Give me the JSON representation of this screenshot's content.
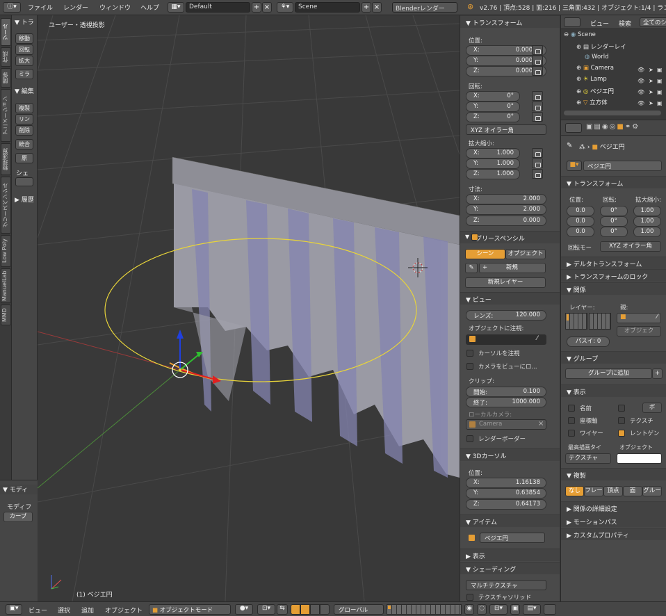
{
  "menu": {
    "items": [
      "ファイル",
      "レンダー",
      "ウィンドウ",
      "ヘルプ"
    ]
  },
  "topbar": {
    "layout": "Default",
    "scene": "Scene",
    "engine": "Blenderレンダー",
    "stats": "v2.76 | 頂点:528 | 面:216 | 三角面:432 | オブジェクト:1/4 | ランプ"
  },
  "shelf": {
    "tabs": [
      "ツール",
      "作成",
      "関係",
      "アニメーション",
      "物理演算",
      "グリースペンシル",
      "Low Poly",
      "ManuelLab",
      "MMD"
    ],
    "transform_head": "▼ トラ",
    "transform_buttons": [
      "移動",
      "回転",
      "拡大",
      "ミラ"
    ],
    "edit_head": "▼ 編集",
    "edit_buttons": [
      "複製",
      "リン",
      "削除",
      "統合",
      "原"
    ],
    "shade_label": "シェ",
    "history_head": "▶ 履歴"
  },
  "operator": {
    "head": "▼ モディ",
    "label": "モディフ",
    "button": "カーブ"
  },
  "viewport": {
    "title": "ユーザー・透視投影",
    "status": "(1) ベジエ円"
  },
  "npanel": {
    "transform": {
      "head": "▼ トランスフォーム",
      "location_label": "位置:",
      "location": [
        {
          "k": "X:",
          "v": "0.00000"
        },
        {
          "k": "Y:",
          "v": "0.00000"
        },
        {
          "k": "Z:",
          "v": "0.00000"
        }
      ],
      "rotation_label": "回転:",
      "rotation": [
        {
          "k": "X:",
          "v": "0°"
        },
        {
          "k": "Y:",
          "v": "0°"
        },
        {
          "k": "Z:",
          "v": "0°"
        }
      ],
      "rotation_mode": "XYZ オイラー角",
      "scale_label": "拡大縮小:",
      "scale": [
        {
          "k": "X:",
          "v": "1.000"
        },
        {
          "k": "Y:",
          "v": "1.000"
        },
        {
          "k": "Z:",
          "v": "1.000"
        }
      ],
      "dims_label": "寸法:",
      "dims": [
        {
          "k": "X:",
          "v": "2.000"
        },
        {
          "k": "Y:",
          "v": "2.000"
        },
        {
          "k": "Z:",
          "v": "0.000"
        }
      ]
    },
    "grease": {
      "head": "グリースペンシル",
      "scene_btn": "シーン",
      "object_btn": "オブジェクト",
      "new_btn": "新規",
      "new_layer_btn": "新規レイヤー"
    },
    "view": {
      "head": "▼ ビュー",
      "lens_label": "レンズ:",
      "lens": "120.000",
      "lock_label": "オブジェクトに注視:",
      "cursor_lock": "カーソルを注視",
      "camera_lock": "カメラをビューにロ...",
      "clip_label": "クリップ:",
      "clip_start_k": "開始:",
      "clip_start": "0.100",
      "clip_end_k": "終了:",
      "clip_end": "1000.000",
      "local_camera_label": "ローカルカメラ:",
      "camera": "Camera",
      "render_border": "レンダーボーダー"
    },
    "cursor": {
      "head": "▼ 3Dカーソル",
      "location_label": "位置:",
      "location": [
        {
          "k": "X:",
          "v": "1.16138"
        },
        {
          "k": "Y:",
          "v": "0.63854"
        },
        {
          "k": "Z:",
          "v": "0.64173"
        }
      ]
    },
    "item": {
      "head": "▼ アイテム",
      "name": "ベジエ円"
    },
    "display_head": "▶ 表示",
    "shading": {
      "head": "▼ シェーディング",
      "mode": "マルチテクスチャ",
      "textured_solid": "テクスチャソリッド"
    }
  },
  "outliner": {
    "view": "ビュー",
    "search": "検索",
    "filter": "全てのシ",
    "items": [
      "Scene",
      "レンダーレイ",
      "World",
      "Camera",
      "Lamp",
      "ベジエ円",
      "立方体"
    ]
  },
  "props": {
    "breadcrumb": "ベジエ円",
    "name": "ベジエ円",
    "transform": {
      "head": "▼ トランスフォーム",
      "loc_label": "位置:",
      "rot_label": "回転:",
      "scale_label": "拡大縮小:",
      "loc": [
        "0.0",
        "0.0",
        "0.0"
      ],
      "rot": [
        "0°",
        "0°",
        "0°"
      ],
      "scale": [
        "1.00",
        "1.00",
        "1.00"
      ],
      "rotmode_label": "回転モー",
      "rotmode": "XYZ オイラー角"
    },
    "delta_head": "▶ デルタトランスフォーム",
    "locks_head": "▶ トランスフォームのロック",
    "relations": {
      "head": "▼ 関係",
      "layers_label": "レイヤー:",
      "parent_label": "親:",
      "object_field": "オブジェク",
      "pass_label": "パスイ: 0"
    },
    "groups": {
      "head": "▼ グループ",
      "add_btn": "グループに追加"
    },
    "display": {
      "head": "▼ 表示",
      "name": "名前",
      "bounds": "ボ",
      "axis": "座標軸",
      "texture_space": "テクスチ",
      "wire": "ワイヤー",
      "xray": "レントゲン",
      "max_draw_label": "最高描画タイ",
      "obj_color_label": "オブジェクト",
      "max_draw": "テクスチャ"
    },
    "dupli": {
      "head": "▼ 複製",
      "options": [
        "なし",
        "フレー",
        "頂点",
        "面",
        "グルー"
      ]
    },
    "relations_extra_head": "▶ 関係の詳細設定",
    "motion_path_head": "▶ モーションパス",
    "custom_props_head": "▶ カスタムプロパティ"
  },
  "bottombar": {
    "menus": [
      "ビュー",
      "選択",
      "追加",
      "オブジェクト"
    ],
    "mode": "オブジェクトモード",
    "orientation": "グローバル"
  },
  "colors": {
    "accent": "#e59e35",
    "curve": "#e8d43a",
    "bg": "#393939",
    "panel": "#4a4a4a"
  }
}
